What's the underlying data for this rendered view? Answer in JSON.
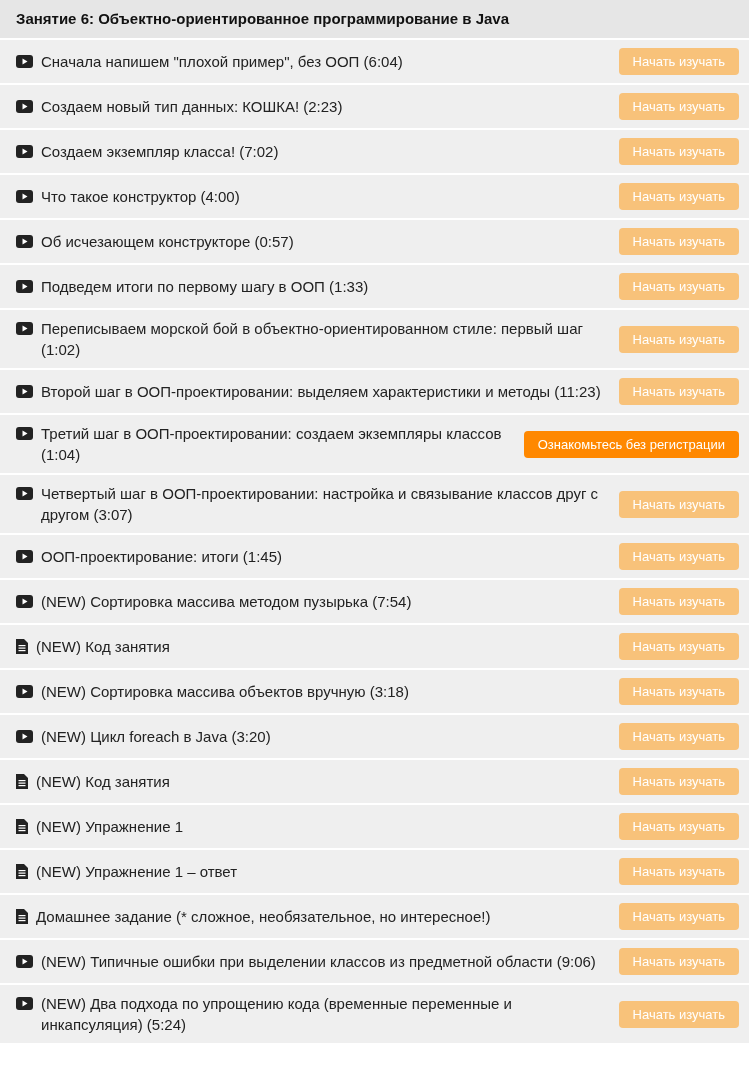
{
  "section": {
    "title": "Занятие 6: Объектно-ориентированное программирование в Java"
  },
  "lessons": [
    {
      "kind": "video",
      "title": "Сначала напишем \"плохой пример\", без ООП (6:04)",
      "button": {
        "kind": "start",
        "label": "Начать изучать"
      }
    },
    {
      "kind": "video",
      "title": "Создаем новый тип данных: КОШКА! (2:23)",
      "button": {
        "kind": "start",
        "label": "Начать изучать"
      }
    },
    {
      "kind": "video",
      "title": "Создаем экземпляр класса! (7:02)",
      "button": {
        "kind": "start",
        "label": "Начать изучать"
      }
    },
    {
      "kind": "video",
      "title": "Что такое конструктор (4:00)",
      "button": {
        "kind": "start",
        "label": "Начать изучать"
      }
    },
    {
      "kind": "video",
      "title": "Об исчезающем конструкторе (0:57)",
      "button": {
        "kind": "start",
        "label": "Начать изучать"
      }
    },
    {
      "kind": "video",
      "title": "Подведем итоги по первому шагу в ООП (1:33)",
      "button": {
        "kind": "start",
        "label": "Начать изучать"
      }
    },
    {
      "kind": "video",
      "title": "Переписываем морской бой в объектно-ориентированном стиле: первый шаг (1:02)",
      "button": {
        "kind": "start",
        "label": "Начать изучать"
      }
    },
    {
      "kind": "video",
      "title": "Второй шаг в ООП-проектировании: выделяем характеристики и методы (11:23)",
      "button": {
        "kind": "start",
        "label": "Начать изучать"
      }
    },
    {
      "kind": "video",
      "title": "Третий шаг в ООП-проектировании: создаем экземпляры классов (1:04)",
      "button": {
        "kind": "preview",
        "label": "Ознакомьтесь без регистрации"
      }
    },
    {
      "kind": "video",
      "title": "Четвертый шаг в ООП-проектировании: настройка и связывание классов друг с другом (3:07)",
      "button": {
        "kind": "start",
        "label": "Начать изучать"
      }
    },
    {
      "kind": "video",
      "title": "ООП-проектирование: итоги (1:45)",
      "button": {
        "kind": "start",
        "label": "Начать изучать"
      }
    },
    {
      "kind": "video",
      "title": "(NEW) Сортировка массива методом пузырька (7:54)",
      "button": {
        "kind": "start",
        "label": "Начать изучать"
      }
    },
    {
      "kind": "document",
      "title": "(NEW) Код занятия",
      "button": {
        "kind": "start",
        "label": "Начать изучать"
      }
    },
    {
      "kind": "video",
      "title": "(NEW) Сортировка массива объектов вручную (3:18)",
      "button": {
        "kind": "start",
        "label": "Начать изучать"
      }
    },
    {
      "kind": "video",
      "title": "(NEW) Цикл foreach в Java (3:20)",
      "button": {
        "kind": "start",
        "label": "Начать изучать"
      }
    },
    {
      "kind": "document",
      "title": "(NEW) Код занятия",
      "button": {
        "kind": "start",
        "label": "Начать изучать"
      }
    },
    {
      "kind": "document",
      "title": "(NEW) Упражнение 1",
      "button": {
        "kind": "start",
        "label": "Начать изучать"
      }
    },
    {
      "kind": "document",
      "title": "(NEW) Упражнение 1 – ответ",
      "button": {
        "kind": "start",
        "label": "Начать изучать"
      }
    },
    {
      "kind": "document",
      "title": "Домашнее задание (* сложное, необязательное, но интересное!)",
      "button": {
        "kind": "start",
        "label": "Начать изучать"
      }
    },
    {
      "kind": "video",
      "title": "(NEW) Типичные ошибки при выделении классов из предметной области (9:06)",
      "button": {
        "kind": "start",
        "label": "Начать изучать"
      }
    },
    {
      "kind": "video",
      "title": "(NEW) Два подхода по упрощению кода (временные переменные и инкапсуляция) (5:24)",
      "button": {
        "kind": "start",
        "label": "Начать изучать"
      }
    }
  ]
}
